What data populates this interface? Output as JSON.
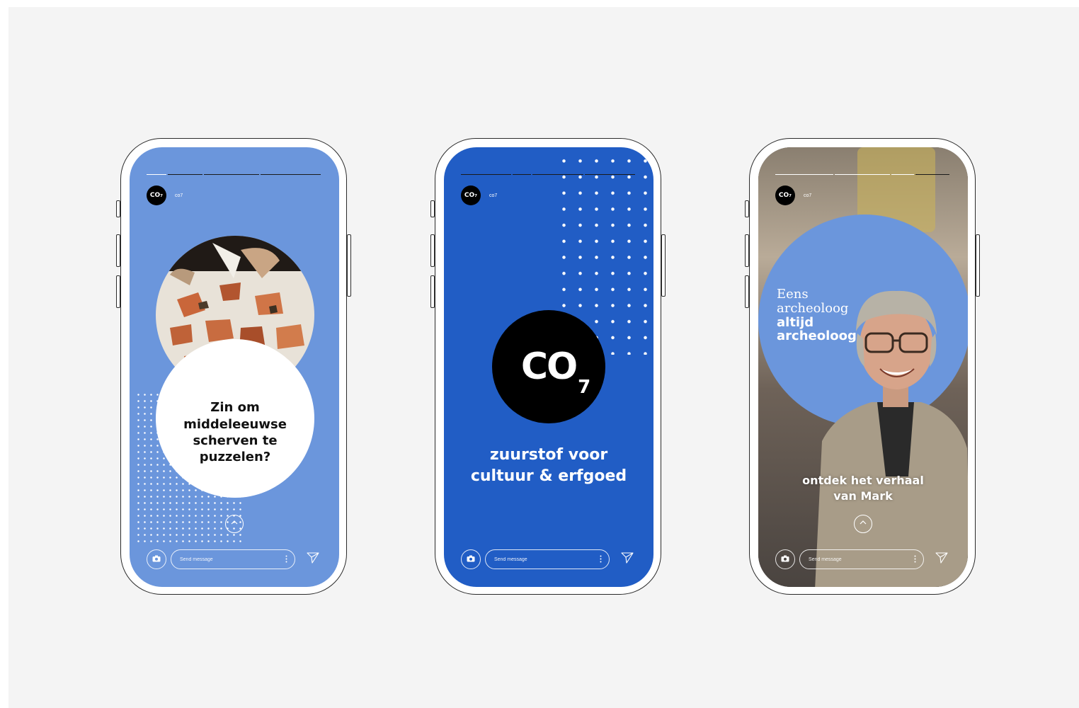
{
  "colors": {
    "background": "#f4f4f4",
    "light_blue": "#6b96dc",
    "royal_blue": "#215dc5",
    "black": "#000000",
    "white": "#ffffff"
  },
  "phones": [
    {
      "account": {
        "avatar_text": "CO₇",
        "name": "co7"
      },
      "progress_segments": 4,
      "question": "Zin om middeleeuwse scherven te puzzelen?",
      "message_placeholder": "Send message",
      "icons": [
        "camera-icon",
        "more-icon",
        "send-icon",
        "chevron-up-icon"
      ]
    },
    {
      "account": {
        "avatar_text": "CO₇",
        "name": "co7"
      },
      "progress_segments": 4,
      "logo": {
        "main": "CO",
        "sub": "7"
      },
      "tagline": "zuurstof voor cultuur & erfgoed",
      "message_placeholder": "Send message",
      "icons": [
        "camera-icon",
        "more-icon",
        "send-icon"
      ]
    },
    {
      "account": {
        "avatar_text": "CO₇",
        "name": "co7"
      },
      "progress_segments": 4,
      "headline_line1": "Eens",
      "headline_line2": "archeoloog",
      "headline_line3": "altijd",
      "headline_line4": "archeoloog",
      "cta_line1": "ontdek het verhaal",
      "cta_line2": "van Mark",
      "message_placeholder": "Send message",
      "icons": [
        "camera-icon",
        "more-icon",
        "send-icon",
        "chevron-up-icon"
      ]
    }
  ]
}
